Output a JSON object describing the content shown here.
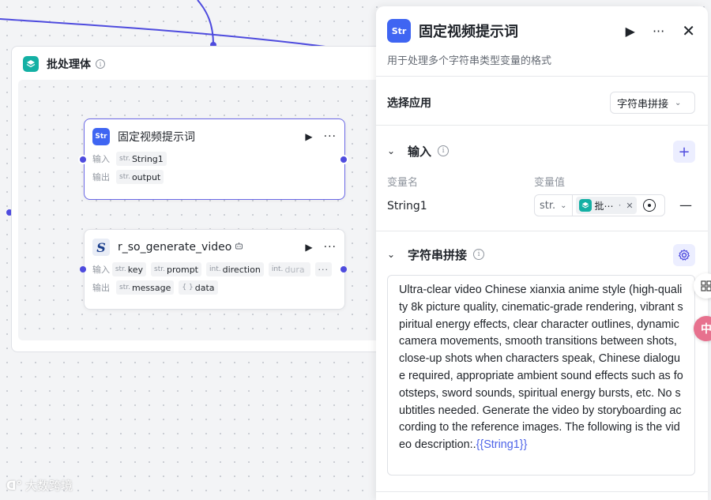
{
  "batch": {
    "title": "批处理体",
    "info_icon": "i"
  },
  "node_fixed": {
    "icon_text": "Str",
    "title": "固定视频提示词",
    "input_label": "输入",
    "output_label": "输出",
    "input_tags": [
      {
        "type": "str.",
        "name": "String1"
      }
    ],
    "output_tags": [
      {
        "type": "str.",
        "name": "output"
      }
    ]
  },
  "node_video": {
    "icon_text": "S",
    "title": "r_so_generate_video",
    "input_label": "输入",
    "output_label": "输出",
    "input_tags": [
      {
        "type": "str.",
        "name": "key"
      },
      {
        "type": "str.",
        "name": "prompt"
      },
      {
        "type": "int.",
        "name": "direction"
      },
      {
        "type": "int.",
        "name": "dura"
      }
    ],
    "more_label": "···",
    "output_tags": [
      {
        "type": "str.",
        "name": "message"
      },
      {
        "type": "{ }",
        "name": "data"
      }
    ]
  },
  "panel": {
    "icon_text": "Str",
    "title": "固定视频提示词",
    "description": "用于处理多个字符串类型变量的格式",
    "select_app_label": "选择应用",
    "select_app_value": "字符串拼接",
    "input_section": "输入",
    "col_var_name": "变量名",
    "col_var_value": "变量值",
    "var_name": "String1",
    "var_type": "str.",
    "ref_label": "批⋯",
    "ref_dot": "·",
    "concat_section": "字符串拼接",
    "concat_text": "Ultra-clear video Chinese xianxia anime style (high-quality 8k picture quality, cinematic-grade rendering, vibrant spiritual energy effects, clear character outlines, dynamic camera movements, smooth transitions between shots, close-up shots when characters speak, Chinese dialogue required, appropriate ambient sound effects such as footsteps, sword sounds, spiritual energy bursts, etc. No subtitles needed. Generate the video by storyboarding according to the reference images. The following is the video description:.",
    "concat_var": "{{String1}}"
  },
  "float": {
    "translate_label": "中"
  },
  "watermark": "大数跨境",
  "colors": {
    "accent": "#4e4bde",
    "teal": "#14b0a4",
    "blue": "#3f65f2"
  }
}
